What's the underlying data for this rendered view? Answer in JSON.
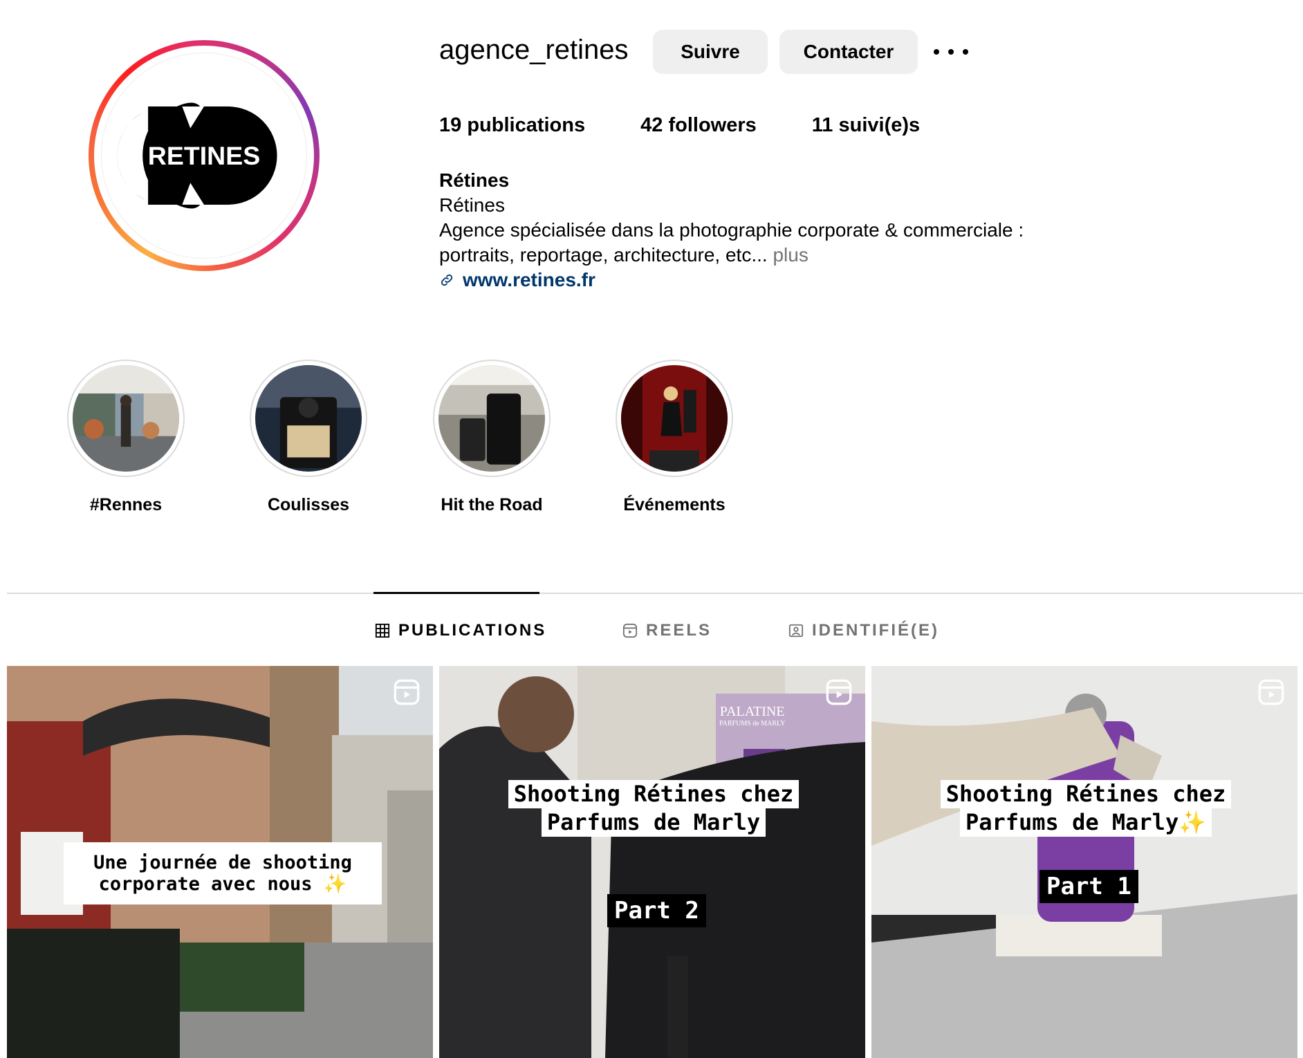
{
  "profile": {
    "username": "agence_retines",
    "follow_label": "Suivre",
    "contact_label": "Contacter",
    "logo_text": "RETINES",
    "stats": {
      "posts_count": "19",
      "posts_word": "publications",
      "followers_count": "42",
      "followers_word": "followers",
      "following_count": "11",
      "following_word": "suivi(e)s"
    },
    "bio": {
      "name": "Rétines",
      "category": "Rétines",
      "line1": "Agence spécialisée dans la photographie corporate & commerciale :",
      "line2": "portraits, reportage, architecture, etc...",
      "more": "plus",
      "website": "www.retines.fr"
    }
  },
  "highlights": [
    {
      "label": "#Rennes",
      "icon": "street-photo"
    },
    {
      "label": "Coulisses",
      "icon": "camera-photo"
    },
    {
      "label": "Hit the Road",
      "icon": "luggage-photo"
    },
    {
      "label": "Événements",
      "icon": "event-photo"
    }
  ],
  "tabs": [
    {
      "label": "PUBLICATIONS",
      "icon": "grid-icon",
      "active": true
    },
    {
      "label": "REELS",
      "icon": "reels-icon",
      "active": false
    },
    {
      "label": "IDENTIFIÉ(E)",
      "icon": "tagged-icon",
      "active": false
    }
  ],
  "posts": [
    {
      "caption_line1": "Une journée de shooting",
      "caption_line2": "corporate avec nous ✨",
      "part": ""
    },
    {
      "caption_line1": "Shooting Rétines chez",
      "caption_line2": "Parfums de Marly",
      "part": "Part 2",
      "sign_text": "PALATINE",
      "sign_sub": "PARFUMS de MARLY"
    },
    {
      "caption_line1": "Shooting Rétines chez",
      "caption_line2": "Parfums de Marly✨",
      "part": "Part 1"
    }
  ],
  "colors": {
    "link": "#00376b",
    "button_bg": "#efefef",
    "muted": "#737373"
  }
}
